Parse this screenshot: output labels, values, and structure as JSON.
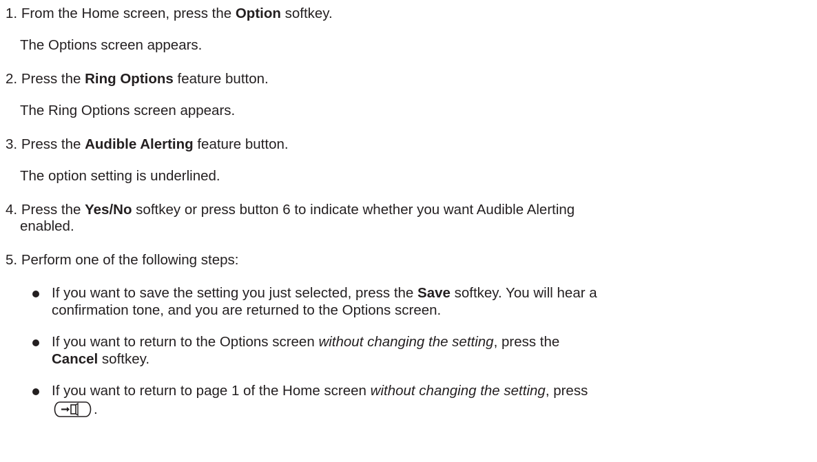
{
  "steps": [
    {
      "number": "1.",
      "pre": "From the Home screen, press the ",
      "bold": "Option",
      "post": " softkey.",
      "note": "The Options screen appears."
    },
    {
      "number": "2.",
      "pre": "Press the ",
      "bold": "Ring Options",
      "post": " feature button.",
      "note": "The Ring Options screen appears."
    },
    {
      "number": "3.",
      "pre": "Press the ",
      "bold": "Audible Alerting",
      "post": " feature button.",
      "note": "The option setting is underlined."
    },
    {
      "number": "4.",
      "pre": "Press the ",
      "bold": "Yes/No",
      "post": " softkey or press button 6 to indicate whether you want Audible Alerting",
      "post2": "enabled."
    },
    {
      "number": "5.",
      "text": "Perform one of the following steps:"
    }
  ],
  "bullets": [
    {
      "line1_pre": "If you want to save the setting you just selected, press the ",
      "line1_bold": "Save",
      "line1_post": " softkey. You will hear a",
      "line2": "confirmation tone, and you are returned to the Options screen."
    },
    {
      "line1_pre": "If you want to return to the Options screen ",
      "line1_italic": "without changing the setting",
      "line1_post": ", press the",
      "line2_bold": "Cancel",
      "line2_post": " softkey."
    },
    {
      "line1_pre": "If you want to return to page 1 of the Home screen ",
      "line1_italic": "without changing the setting",
      "line1_post": ", press",
      "line2_post": "."
    }
  ],
  "icons": {
    "home_key": "home-exit-key-icon"
  }
}
